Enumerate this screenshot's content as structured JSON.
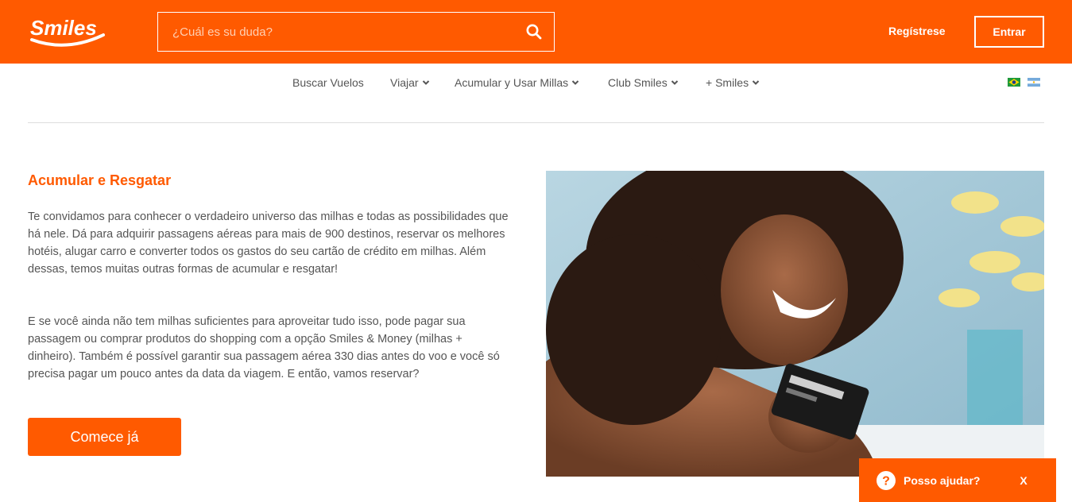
{
  "header": {
    "logo_text": "Smiles",
    "search_placeholder": "¿Cuál es su duda?",
    "register_label": "Regístrese",
    "enter_label": "Entrar"
  },
  "nav": {
    "items": [
      {
        "label": "Buscar Vuelos",
        "has_dropdown": false
      },
      {
        "label": "Viajar",
        "has_dropdown": true
      },
      {
        "label": "Acumular y Usar Millas",
        "has_dropdown": true
      },
      {
        "label": "Club Smiles",
        "has_dropdown": true
      },
      {
        "label": "+ Smiles",
        "has_dropdown": true
      }
    ],
    "flags": [
      "brazil-flag-icon",
      "argentina-flag-icon"
    ]
  },
  "content": {
    "heading": "Acumular e Resgatar",
    "paragraph1": "Te convidamos para conhecer o verdadeiro universo das milhas e todas as possibilidades que há nele. Dá para adquirir passagens aéreas para mais de 900 destinos, reservar os melhores hotéis, alugar carro e converter todos os gastos do seu cartão de crédito em milhas. Além dessas, temos muitas outras formas de acumular e resgatar!",
    "paragraph2": "E se você ainda não tem milhas suficientes para aproveitar tudo isso, pode pagar sua passagem ou comprar produtos do shopping com a opção Smiles & Money (milhas + dinheiro). Também é possível garantir sua passagem aérea 330 dias antes do voo e você só precisa pagar um pouco antes da data da viagem. E então, vamos reservar?",
    "cta_label": "Comece já"
  },
  "help_widget": {
    "label": "Posso ajudar?",
    "close_label": "X"
  },
  "colors": {
    "brand_orange": "#ff5a00",
    "body_text": "#555555",
    "divider": "#dddddd"
  }
}
